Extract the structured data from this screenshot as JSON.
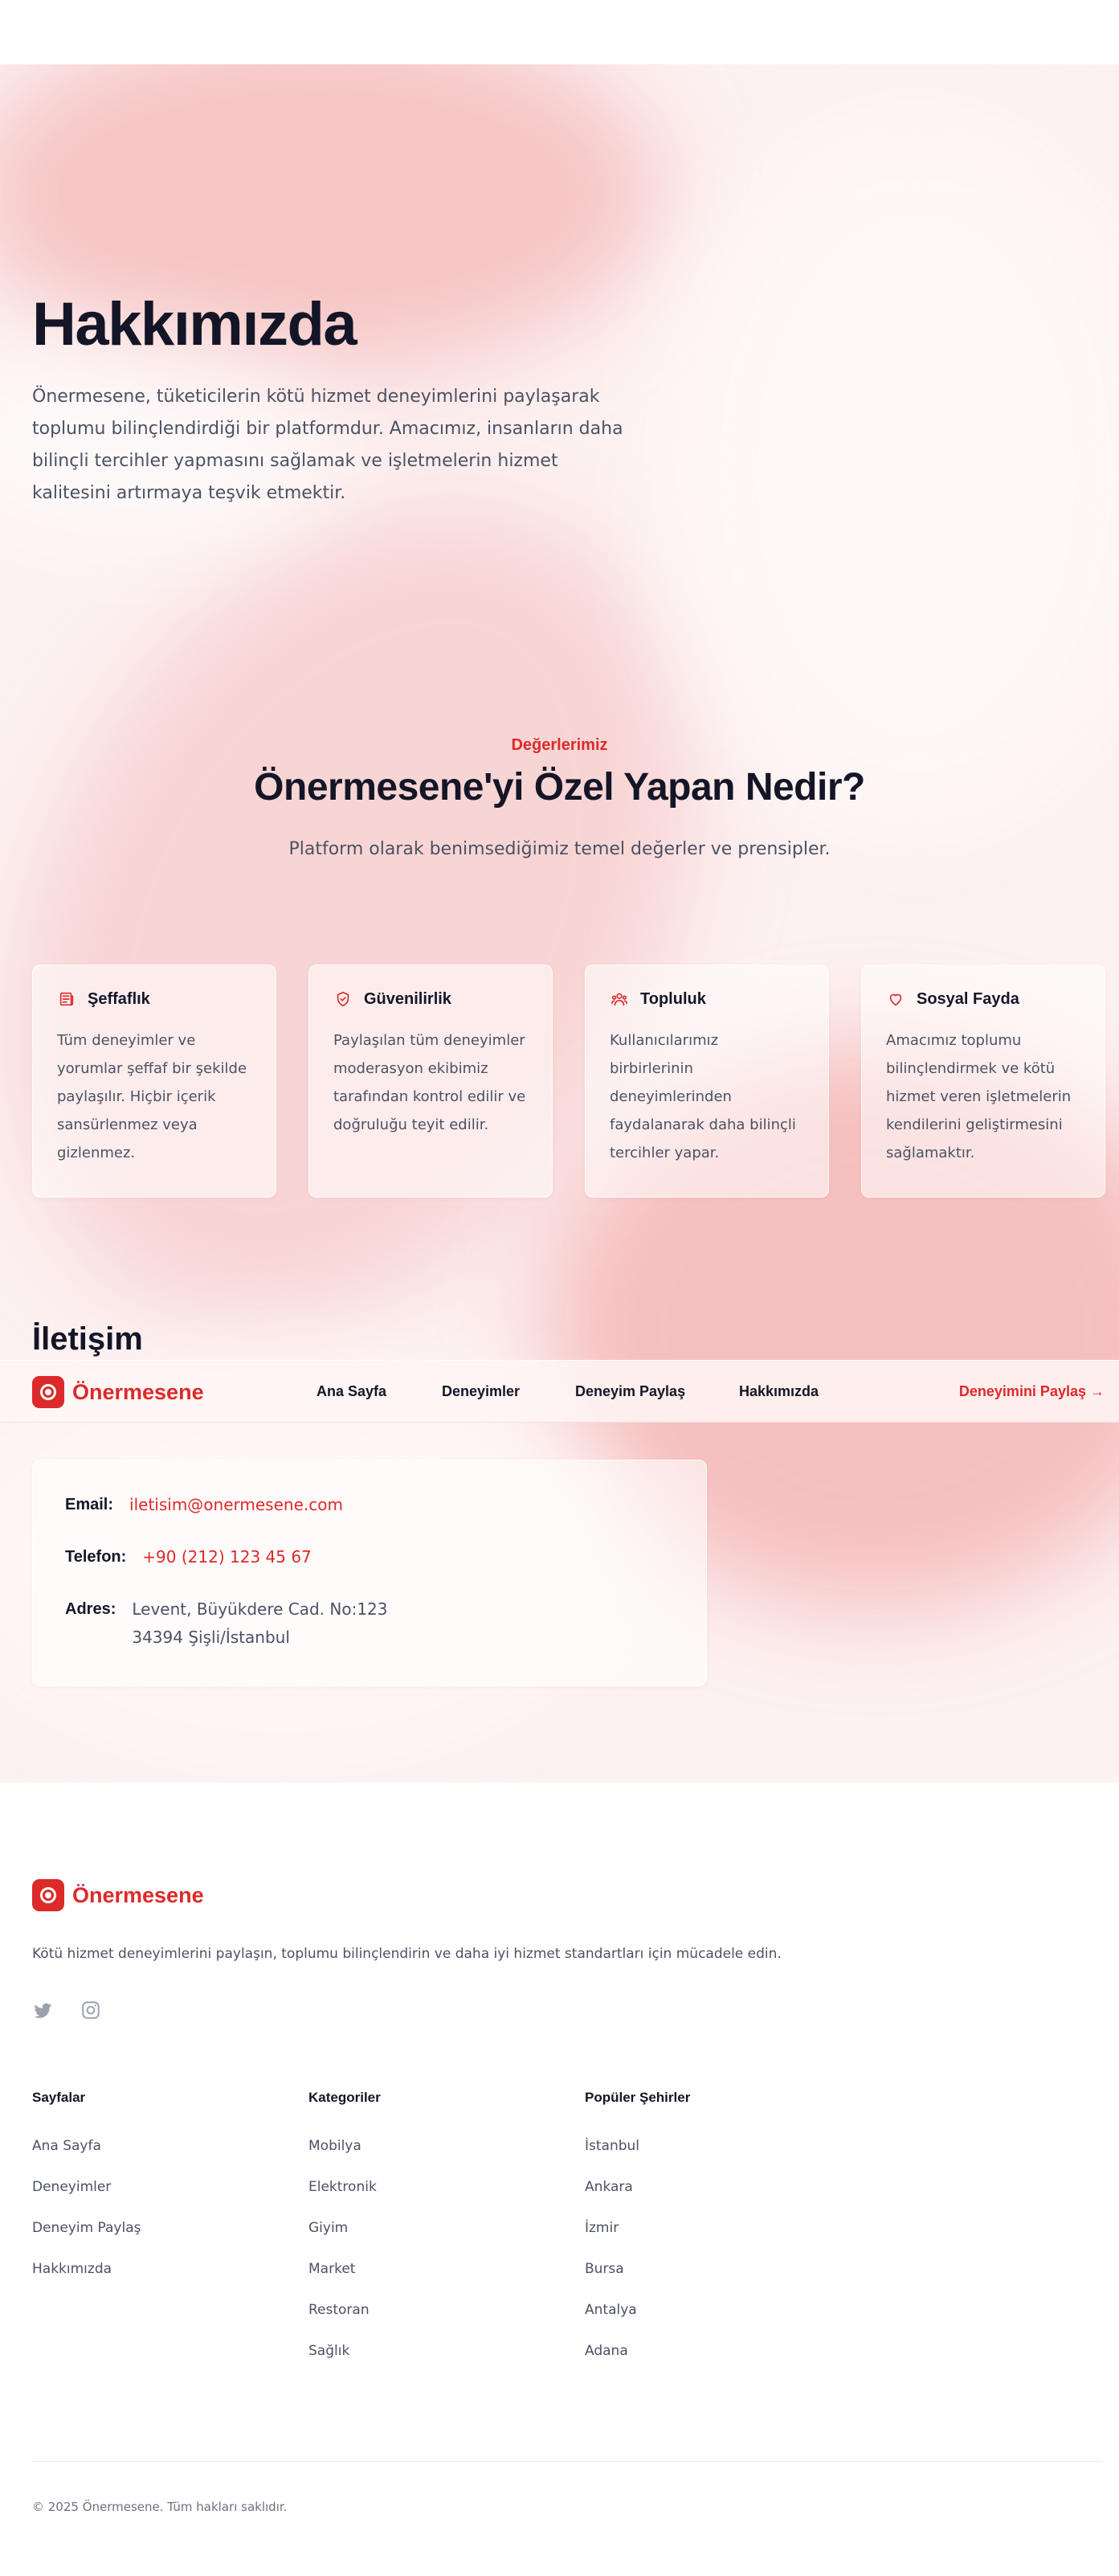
{
  "hero": {
    "title": "Hakkımızda",
    "text": "Önermesene, tüketicilerin kötü hizmet deneyimlerini paylaşarak toplumu bilinçlendirdiği bir platformdur. Amacımız, insanların daha bilinçli tercihler yapmasını sağlamak ve işletmelerin hizmet kalitesini artırmaya teşvik etmektir."
  },
  "values": {
    "eyebrow": "Değerlerimiz",
    "title": "Önermesene'yi Özel Yapan Nedir?",
    "subtitle": "Platform olarak benimsediğimiz temel değerler ve prensipler.",
    "cards": [
      {
        "icon": "newspaper-icon",
        "title": "Şeffaflık",
        "text": "Tüm deneyimler ve yorumlar şeffaf bir şekilde paylaşılır. Hiçbir içerik sansürlenmez veya gizlenmez."
      },
      {
        "icon": "shield-check-icon",
        "title": "Güvenilirlik",
        "text": "Paylaşılan tüm deneyimler moderasyon ekibimiz tarafından kontrol edilir ve doğruluğu teyit edilir."
      },
      {
        "icon": "users-icon",
        "title": "Topluluk",
        "text": "Kullanıcılarımız birbirlerinin deneyimlerinden faydalanarak daha bilinçli tercihler yapar."
      },
      {
        "icon": "heart-icon",
        "title": "Sosyal Fayda",
        "text": "Amacımız toplumu bilinçlendirmek ve kötü hizmet veren işletmelerin kendilerini geliştirmesini sağlamaktır."
      }
    ]
  },
  "contact": {
    "title": "İletişim",
    "email_label": "Email:",
    "email": "iletisim@onermesene.com",
    "phone_label": "Telefon:",
    "phone": "+90 (212) 123 45 67",
    "address_label": "Adres:",
    "address_line1": "Levent, Büyükdere Cad. No:123",
    "address_line2": "34394 Şişli/İstanbul"
  },
  "navbar": {
    "brand": "Önermesene",
    "links": [
      "Ana Sayfa",
      "Deneyimler",
      "Deneyim Paylaş",
      "Hakkımızda"
    ],
    "cta": "Deneyimini Paylaş →"
  },
  "footer": {
    "brand": "Önermesene",
    "description": "Kötü hizmet deneyimlerini paylaşın, toplumu bilinçlendirin ve daha iyi hizmet standartları için mücadele edin.",
    "social": [
      "twitter-icon",
      "instagram-icon"
    ],
    "columns": [
      {
        "title": "Sayfalar",
        "items": [
          "Ana Sayfa",
          "Deneyimler",
          "Deneyim Paylaş",
          "Hakkımızda"
        ]
      },
      {
        "title": "Kategoriler",
        "items": [
          "Mobilya",
          "Elektronik",
          "Giyim",
          "Market",
          "Restoran",
          "Sağlık"
        ]
      },
      {
        "title": "Popüler Şehirler",
        "items": [
          "İstanbul",
          "Ankara",
          "İzmir",
          "Bursa",
          "Antalya",
          "Adana"
        ]
      }
    ],
    "copyright": "© 2025 Önermesene. Tüm hakları saklıdır."
  },
  "colors": {
    "accent": "#dc2a2a",
    "heading": "#141627",
    "body_text": "#4b5264",
    "hero_bg": "#fdf1f1"
  }
}
